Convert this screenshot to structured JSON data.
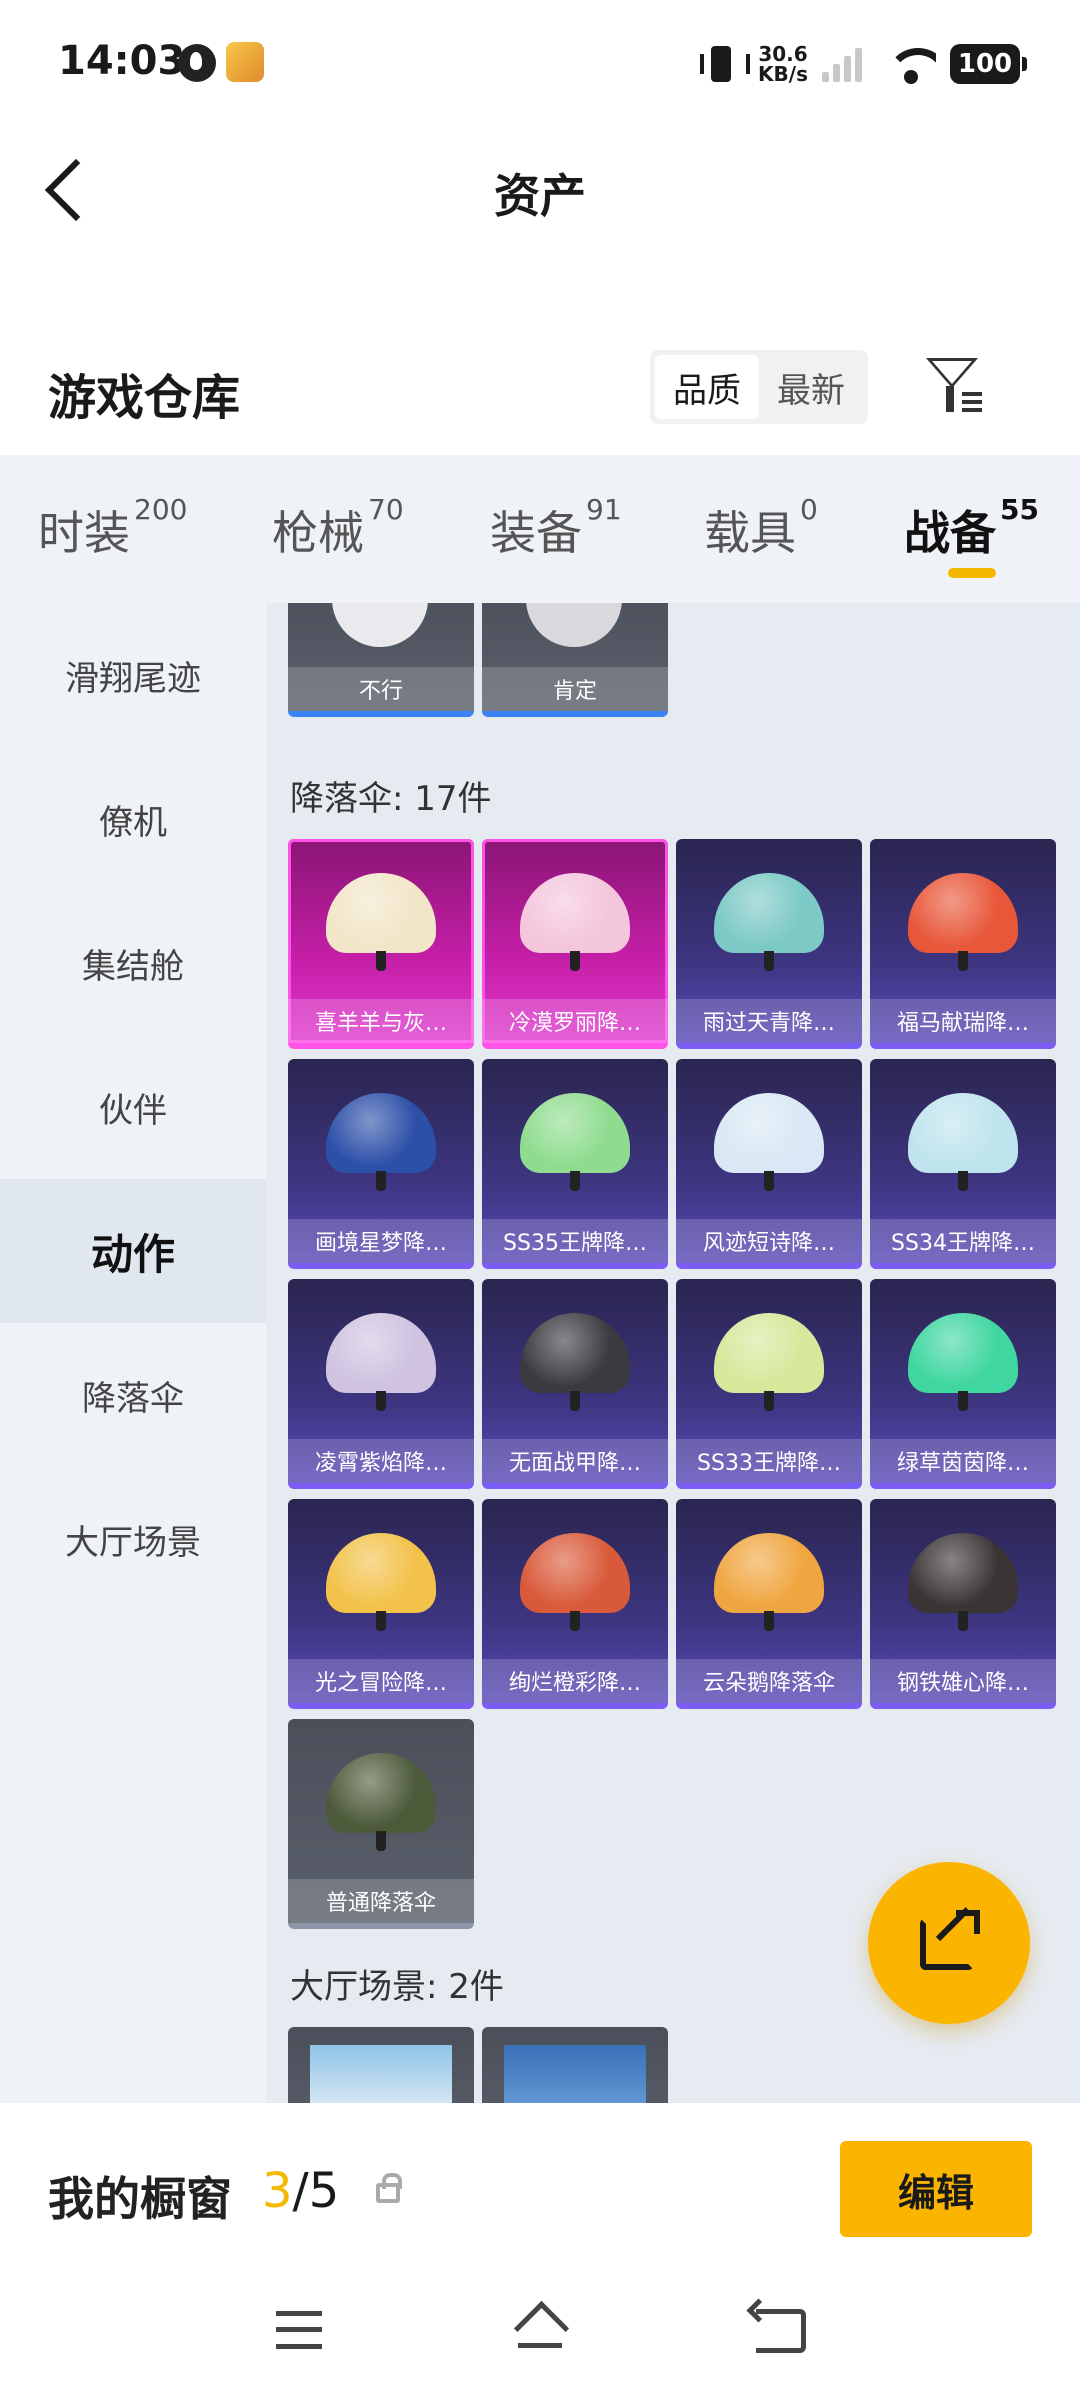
{
  "status_bar": {
    "time": "14:03",
    "speed_value": "30.6",
    "speed_unit": "KB/s",
    "battery": "100"
  },
  "header": {
    "title": "资产"
  },
  "warehouse": {
    "title": "游戏仓库",
    "sort_options": [
      "品质",
      "最新"
    ],
    "active_sort": "品质"
  },
  "category_tabs": [
    {
      "label": "时装",
      "count": "200"
    },
    {
      "label": "枪械",
      "count": "70"
    },
    {
      "label": "装备",
      "count": "91"
    },
    {
      "label": "载具",
      "count": "0"
    },
    {
      "label": "战备",
      "count": "55",
      "active": true
    }
  ],
  "sidebar": {
    "items": [
      "滑翔尾迹",
      "僚机",
      "集结舱",
      "伙伴",
      "动作",
      "降落伞",
      "大厅场景"
    ],
    "active": "动作"
  },
  "content": {
    "action_cards": [
      {
        "label": "不行"
      },
      {
        "label": "肯定"
      }
    ],
    "parachute_section": "降落伞: 17件",
    "parachutes": [
      {
        "label": "喜羊羊与灰…",
        "rarity": "pink",
        "color": "#f2e6c8"
      },
      {
        "label": "冷漠罗丽降…",
        "rarity": "pink",
        "color": "#f4c6dc"
      },
      {
        "label": "雨过天青降…",
        "rarity": "purple",
        "color": "#7cc9c6"
      },
      {
        "label": "福马献瑞降…",
        "rarity": "purple",
        "color": "#e8573a"
      },
      {
        "label": "画境星梦降…",
        "rarity": "purple",
        "color": "#2c4fa8"
      },
      {
        "label": "SS35王牌降…",
        "rarity": "purple",
        "color": "#8fdc8f"
      },
      {
        "label": "风迹短诗降…",
        "rarity": "purple",
        "color": "#d9e8f4"
      },
      {
        "label": "SS34王牌降…",
        "rarity": "purple",
        "color": "#bfe4ee"
      },
      {
        "label": "凌霄紫焰降…",
        "rarity": "purple",
        "color": "#cfc3e0"
      },
      {
        "label": "无面战甲降…",
        "rarity": "purple",
        "color": "#3a3a40"
      },
      {
        "label": "SS33王牌降…",
        "rarity": "purple",
        "color": "#d6e89a"
      },
      {
        "label": "绿草茵茵降…",
        "rarity": "purple",
        "color": "#3fd6a0"
      },
      {
        "label": "光之冒险降…",
        "rarity": "purple",
        "color": "#f2c24a"
      },
      {
        "label": "绚烂橙彩降…",
        "rarity": "purple",
        "color": "#d95a3a"
      },
      {
        "label": "云朵鹅降落伞",
        "rarity": "purple",
        "color": "#f0a640"
      },
      {
        "label": "钢铁雄心降…",
        "rarity": "purple",
        "color": "#3b3434"
      },
      {
        "label": "普通降落伞",
        "rarity": "gray",
        "color": "#4d5a3a"
      }
    ],
    "lobby_section": "大厅场景: 2件"
  },
  "window_bar": {
    "title": "我的橱窗",
    "current": "3",
    "total": "/5",
    "edit_label": "编辑"
  },
  "colors": {
    "accent": "#fbb400",
    "tab_bg": "#eff3f7",
    "content_bg": "#e6ebf1"
  }
}
